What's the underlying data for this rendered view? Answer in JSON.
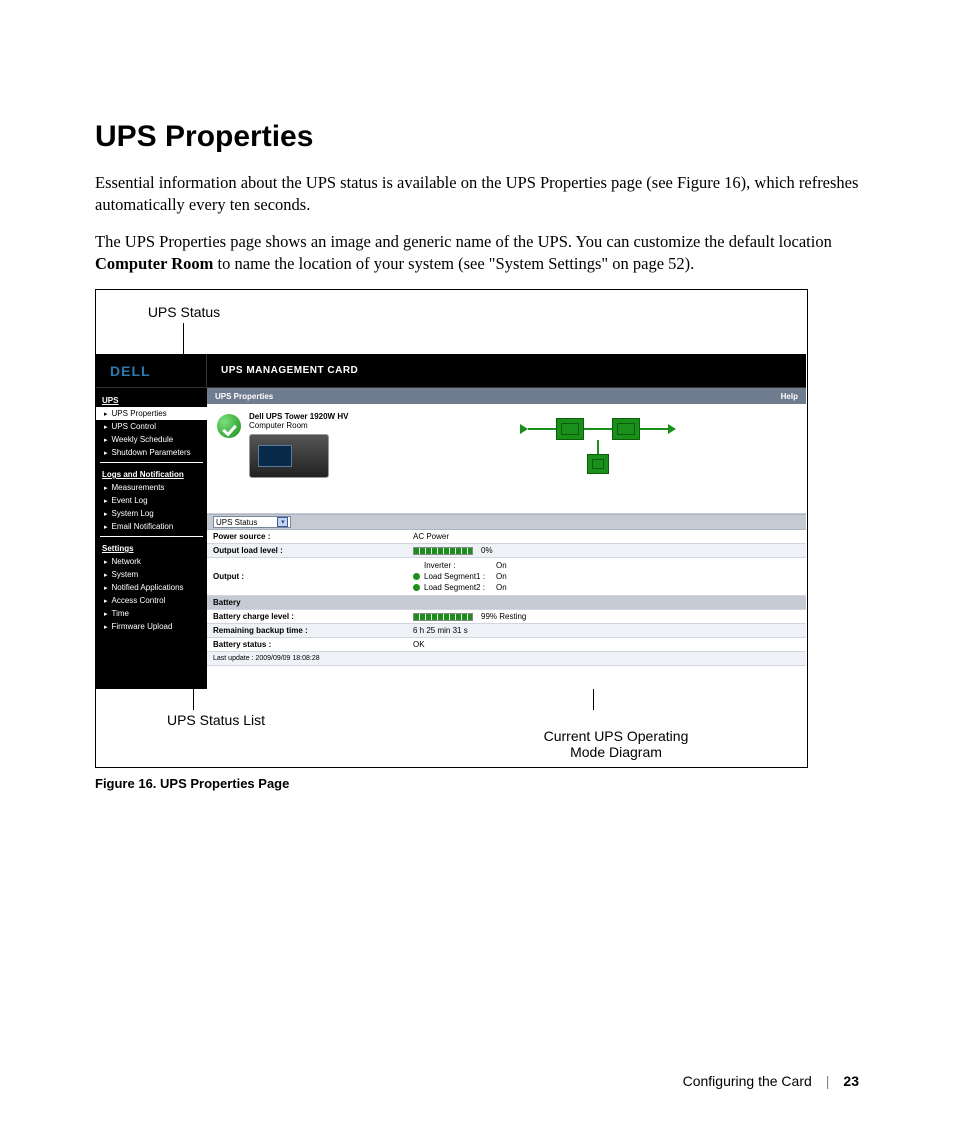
{
  "page": {
    "title": "UPS Properties",
    "para1": "Essential information about the UPS status is available on the UPS Properties page (see Figure 16), which refreshes automatically every ten seconds.",
    "para2_a": "The UPS Properties page shows an image and generic name of the UPS. You can customize the default location ",
    "para2_b": "Computer Room",
    "para2_c": " to name the location of your system (see \"System Settings\" on page 52).",
    "figure_caption": "Figure 16. UPS Properties Page",
    "footer_section": "Configuring the Card",
    "footer_page": "23"
  },
  "callouts": {
    "ups_status": "UPS Status",
    "ups_status_list": "UPS Status List",
    "mode_diagram": "Current UPS Operating\nMode Diagram"
  },
  "screenshot": {
    "logo": "DELL",
    "header_title": "UPS MANAGEMENT CARD",
    "panel_title": "UPS Properties",
    "help": "Help",
    "device_name": "Dell UPS Tower 1920W HV",
    "device_location": "Computer Room",
    "select_label": "UPS Status",
    "nav": {
      "ups": "UPS",
      "ups_items": [
        "UPS Properties",
        "UPS Control",
        "Weekly Schedule",
        "Shutdown Parameters"
      ],
      "logs": "Logs and Notification",
      "logs_items": [
        "Measurements",
        "Event Log",
        "System Log",
        "Email Notification"
      ],
      "settings": "Settings",
      "settings_items": [
        "Network",
        "System",
        "Notified Applications",
        "Access Control",
        "Time",
        "Firmware Upload"
      ]
    },
    "rows": {
      "power_source_label": "Power source :",
      "power_source_val": "AC Power",
      "output_load_label": "Output load level :",
      "output_load_val": "0%",
      "output_label": "Output :",
      "inverter_label": "Inverter :",
      "inverter_val": "On",
      "seg1_label": "Load Segment1 :",
      "seg1_val": "On",
      "seg2_label": "Load Segment2 :",
      "seg2_val": "On",
      "battery_header": "Battery",
      "batt_charge_label": "Battery charge level :",
      "batt_charge_val": "99%  Resting",
      "remaining_label": "Remaining backup time :",
      "remaining_val": "6 h 25 min 31 s",
      "batt_status_label": "Battery status :",
      "batt_status_val": "OK",
      "last_update": "Last update : 2009/09/09 18:08:28"
    }
  }
}
